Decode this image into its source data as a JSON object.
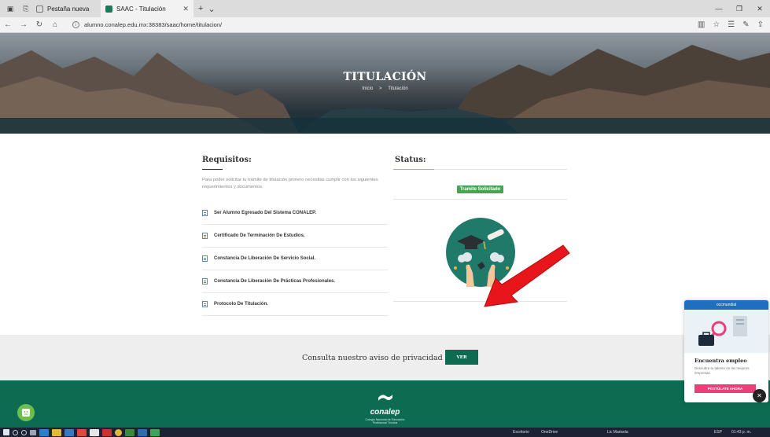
{
  "browser": {
    "tabs": [
      {
        "label": "Pestaña nueva",
        "active": false
      },
      {
        "label": "SAAC - Titulación",
        "active": true
      }
    ],
    "url": "alumno.conalep.edu.mx:38383/saac/home/titulacion/"
  },
  "hero": {
    "title": "TITULACIÓN",
    "breadcrumb": {
      "home": "Inicio",
      "separator": ">",
      "current": "Titulación"
    }
  },
  "requisitos": {
    "title": "Requisitos:",
    "intro": "Para poder solicitar tu trámite de titulación primero necesitas cumplir con los siguientes requerimientos y documentos.",
    "items": [
      {
        "label": "Ser Alumno Egresado Del Sistema CONALEP."
      },
      {
        "label": "Certificado De Terminación De Estudios."
      },
      {
        "label": "Constancia De Liberación De Servicio Social."
      },
      {
        "label": "Constancia De Liberación De Prácticas Profesionales."
      },
      {
        "label": "Protocolo De Titulación."
      }
    ]
  },
  "status": {
    "title": "Status:",
    "badge": "Tramite Solicitado",
    "badge_color": "#4aa355"
  },
  "privacy": {
    "text": "Consulta nuestro aviso de privacidad",
    "button": "VER"
  },
  "footer": {
    "brand": "conalep",
    "subtitle_line1": "Colegio Nacional de Educación",
    "subtitle_line2": "Profesional Técnica",
    "brand_color": "#0d6b52"
  },
  "ad": {
    "brand": "occmundial",
    "title": "Encuentra empleo",
    "description": "Descubre tu talento en las mejores empresas",
    "button": "POSTÚLATE AHORA"
  },
  "taskbar": {
    "escritorio": "Escritorio",
    "onedrive": "OneDrive",
    "user": "Lic Marisela",
    "lang": "ESP",
    "time": "01:43 p. m."
  }
}
